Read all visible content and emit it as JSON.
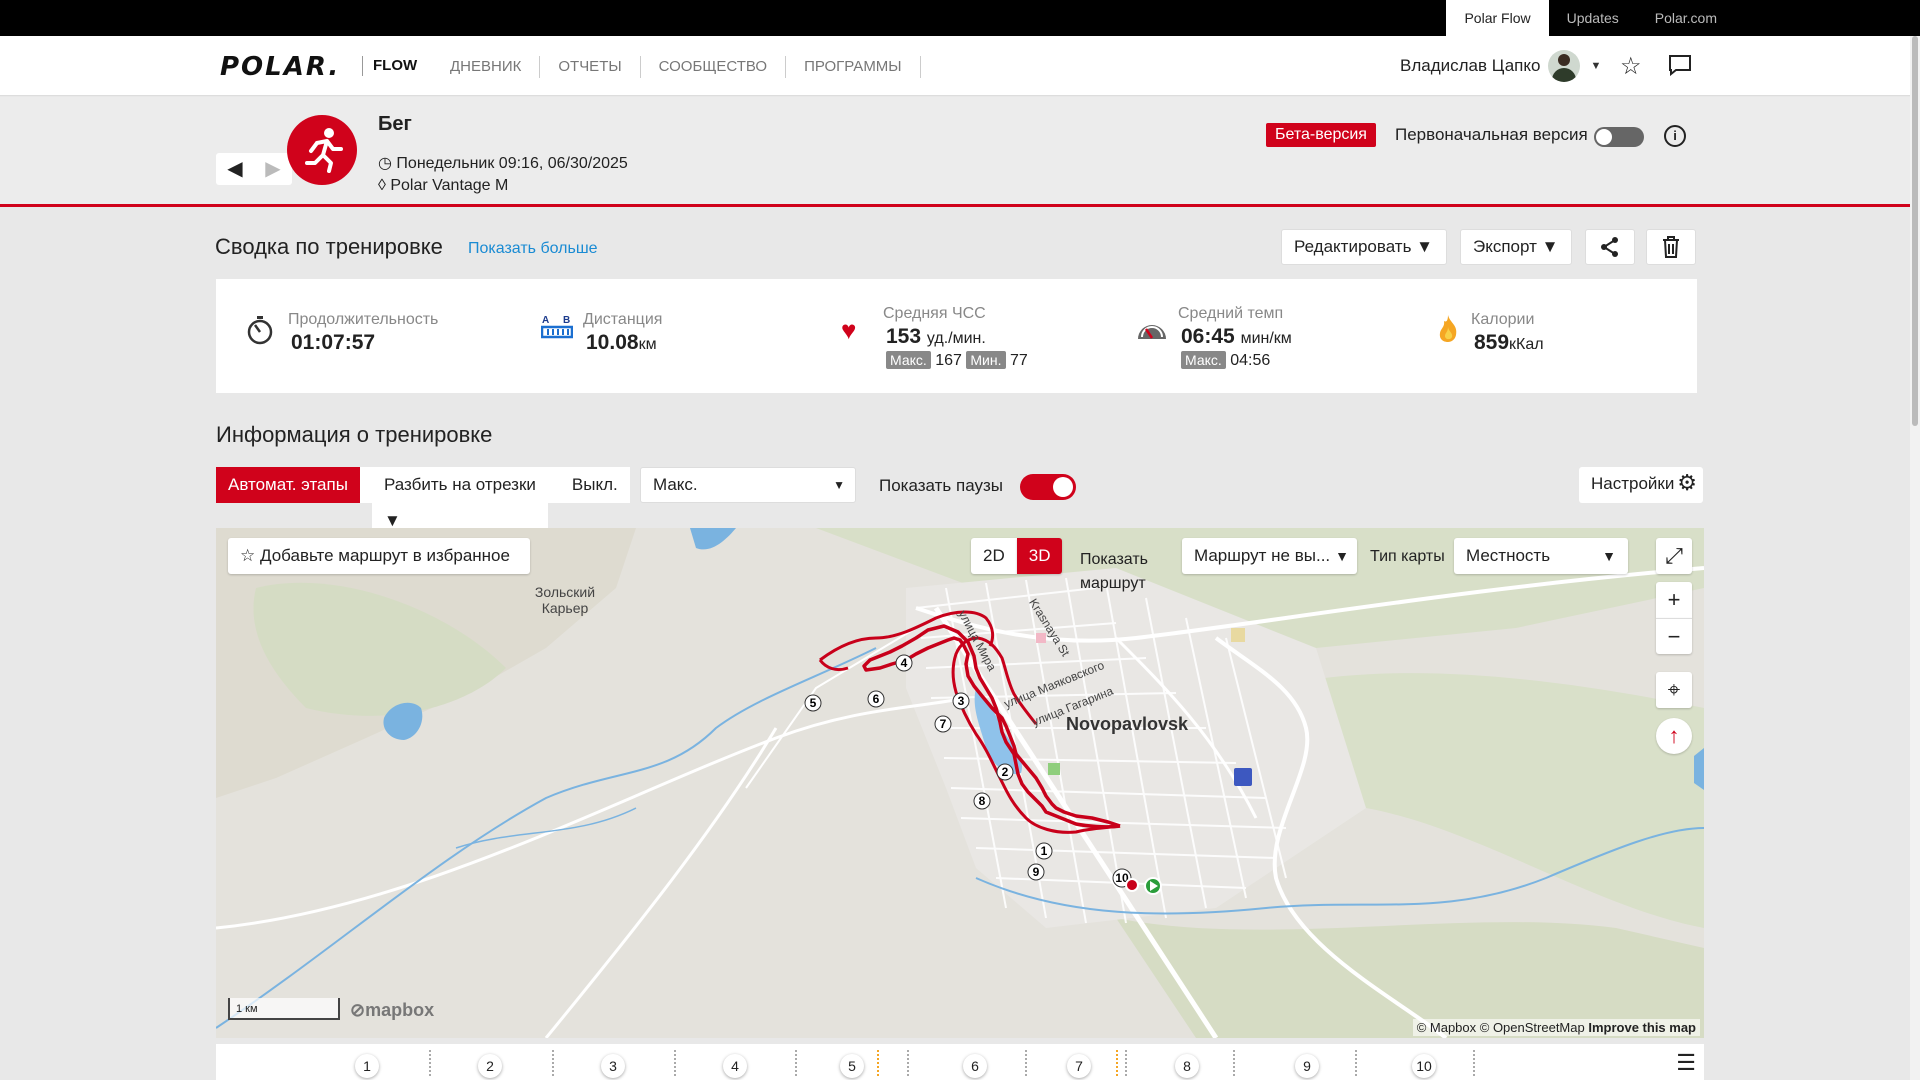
{
  "topbar": {
    "links": [
      "Polar Flow",
      "Updates",
      "Polar.com"
    ]
  },
  "header": {
    "logo": "POLAR.",
    "flow": "FLOW",
    "nav": [
      "ДНЕВНИК",
      "ОТЧЕТЫ",
      "СООБЩЕСТВО",
      "ПРОГРАММЫ"
    ],
    "user_name": "Владислав Цапко"
  },
  "activity": {
    "title": "Бег",
    "date": "Понедельник 09:16, 06/30/2025",
    "device": "Polar Vantage M",
    "beta": "Бета-версия",
    "original_version": "Первоначальная версия"
  },
  "summary": {
    "title": "Сводка по тренировке",
    "show_more": "Показать больше",
    "edit": "Редактировать",
    "export": "Экспорт",
    "duration_label": "Продолжительность",
    "duration_value": "01:07:57",
    "distance_label": "Дистанция",
    "distance_value": "10.08",
    "distance_unit": "км",
    "hr_label": "Средняя ЧСС",
    "hr_value": "153",
    "hr_unit": "уд./мин.",
    "max_label": "Макс.",
    "hr_max": "167",
    "min_label": "Мин.",
    "hr_min": "77",
    "pace_label": "Средний темп",
    "pace_value": "06:45",
    "pace_unit": "мин/км",
    "pace_max": "04:56",
    "cal_label": "Калории",
    "cal_value": "859",
    "cal_unit": "кКал"
  },
  "info": {
    "title": "Информация о тренировке",
    "auto_laps": "Автомат. этапы",
    "split": "Разбить на отрезки",
    "off": "Выкл.",
    "metric_select": "Макс.",
    "show_pauses": "Показать паузы",
    "settings": "Настройки"
  },
  "map": {
    "favorite": "Добавьте маршрут в избранное",
    "mode_2d": "2D",
    "mode_3d": "3D",
    "show_route": "Показать маршрут",
    "route_select": "Маршрут не вы...",
    "map_type_label": "Тип карты",
    "map_type": "Местность",
    "labels": {
      "quarry": "Зольский Карьер",
      "mira": "улица Мира",
      "krasnaya": "Krasnaya St",
      "mayak": "улица Маяковского",
      "gagarina": "улица Гагарина",
      "city": "Novopavlovsk"
    },
    "scale": "1 км",
    "mapbox": "mapbox",
    "attribution": "© Mapbox © OpenStreetMap",
    "improve": "Improve this map"
  },
  "laps": [
    "1",
    "2",
    "3",
    "4",
    "5",
    "6",
    "7",
    "8",
    "9",
    "10"
  ],
  "colors": {
    "accent": "#d0021b",
    "link": "#1a8bd3"
  }
}
